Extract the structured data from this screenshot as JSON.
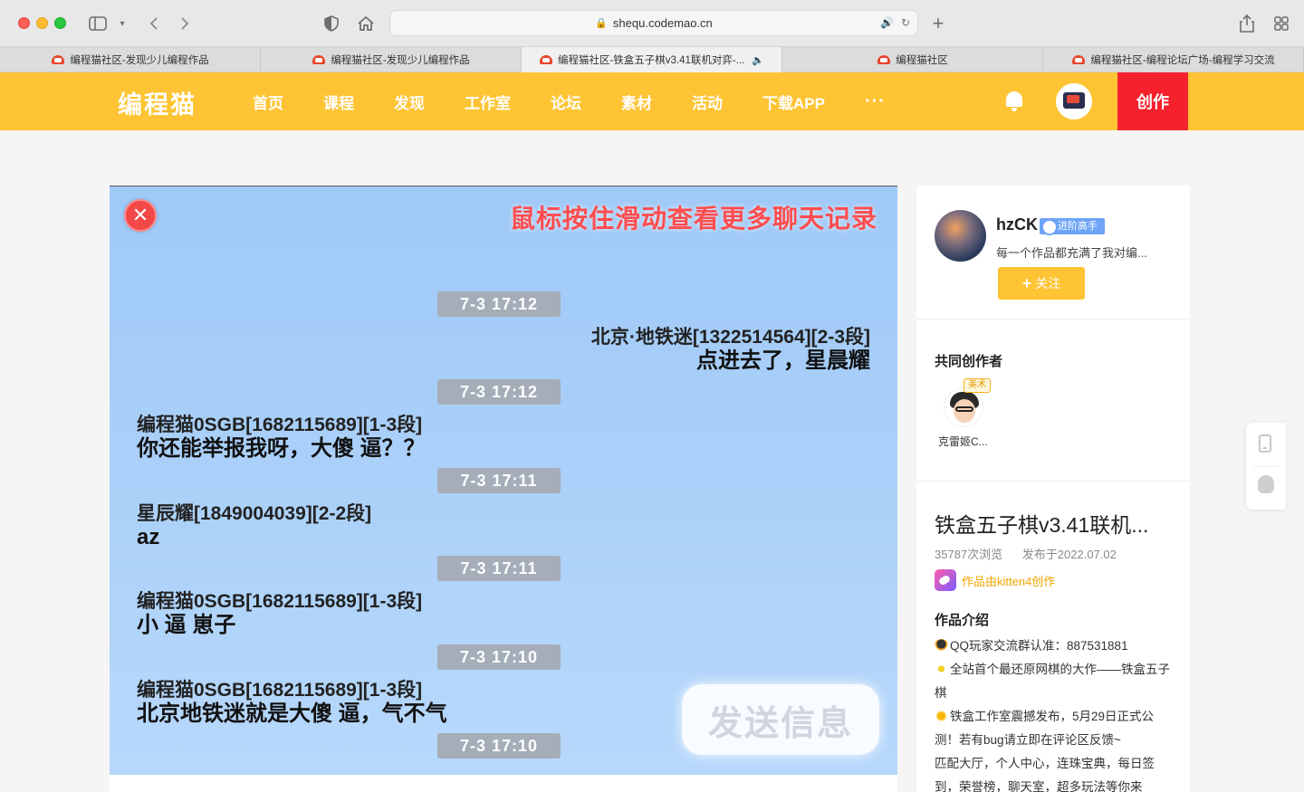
{
  "browser": {
    "url": "shequ.codemao.cn",
    "tabs": [
      {
        "label": "编程猫社区-发现少儿编程作品"
      },
      {
        "label": "编程猫社区-发现少儿编程作品"
      },
      {
        "label": "编程猫社区-铁盒五子棋v3.41联机对弈-..."
      },
      {
        "label": "编程猫社区"
      },
      {
        "label": "编程猫社区-编程论坛广场-编程学习交流"
      }
    ]
  },
  "header": {
    "logo": "编程猫",
    "nav": [
      "首页",
      "课程",
      "发现",
      "工作室",
      "论坛",
      "素材",
      "活动",
      "下载APP"
    ],
    "more": "···",
    "create": "创作",
    "brand_color": "#fec433",
    "create_color": "#f5222d"
  },
  "game": {
    "hint": "鼠标按住滑动查看更多聊天记录",
    "send_button": "发送信息",
    "messages": [
      {
        "time": "7-3  17:12"
      },
      {
        "sender": "北京·地铁迷[1322514564][2-3段]",
        "text": "点进去了，星晨耀",
        "align": "right"
      },
      {
        "time": "7-3  17:12"
      },
      {
        "sender": "编程猫0SGB[1682115689][1-3段]",
        "text": "你还能举报我呀，大傻 逼？？",
        "align": "left"
      },
      {
        "time": "7-3  17:11"
      },
      {
        "sender": "星辰耀[1849004039][2-2段]",
        "text": "az",
        "align": "left"
      },
      {
        "time": "7-3  17:11"
      },
      {
        "sender": "编程猫0SGB[1682115689][1-3段]",
        "text": "小 逼 崽子",
        "align": "left"
      },
      {
        "time": "7-3  17:10"
      },
      {
        "sender": "编程猫0SGB[1682115689][1-3段]",
        "text": "北京地铁迷就是大傻 逼，气不气",
        "align": "left"
      },
      {
        "time": "7-3  17:10"
      }
    ]
  },
  "author": {
    "name": "hzCK",
    "badge": "进阶高手",
    "signature": "每一个作品都充满了我对编...",
    "follow": "关注"
  },
  "coauthors": {
    "title": "共同创作者",
    "items": [
      {
        "name": "克雷姬C...",
        "tag": "美术"
      }
    ]
  },
  "work": {
    "title": "铁盒五子棋v3.41联机...",
    "views": "35787次浏览",
    "published": "发布于2022.07.02",
    "made_with": "作品由kitten4创作",
    "intro_title": "作品介绍",
    "intro_lines": [
      "QQ玩家交流群认准：887531881",
      "全站首个最还原网棋的大作——铁盒五子棋",
      "铁盒工作室震撼发布，5月29日正式公测！若有bug请立即在评论区反馈~",
      "匹配大厅，个人中心，连珠宝典，每日签到，荣誉榜，聊天室，超多玩法等你来"
    ]
  }
}
